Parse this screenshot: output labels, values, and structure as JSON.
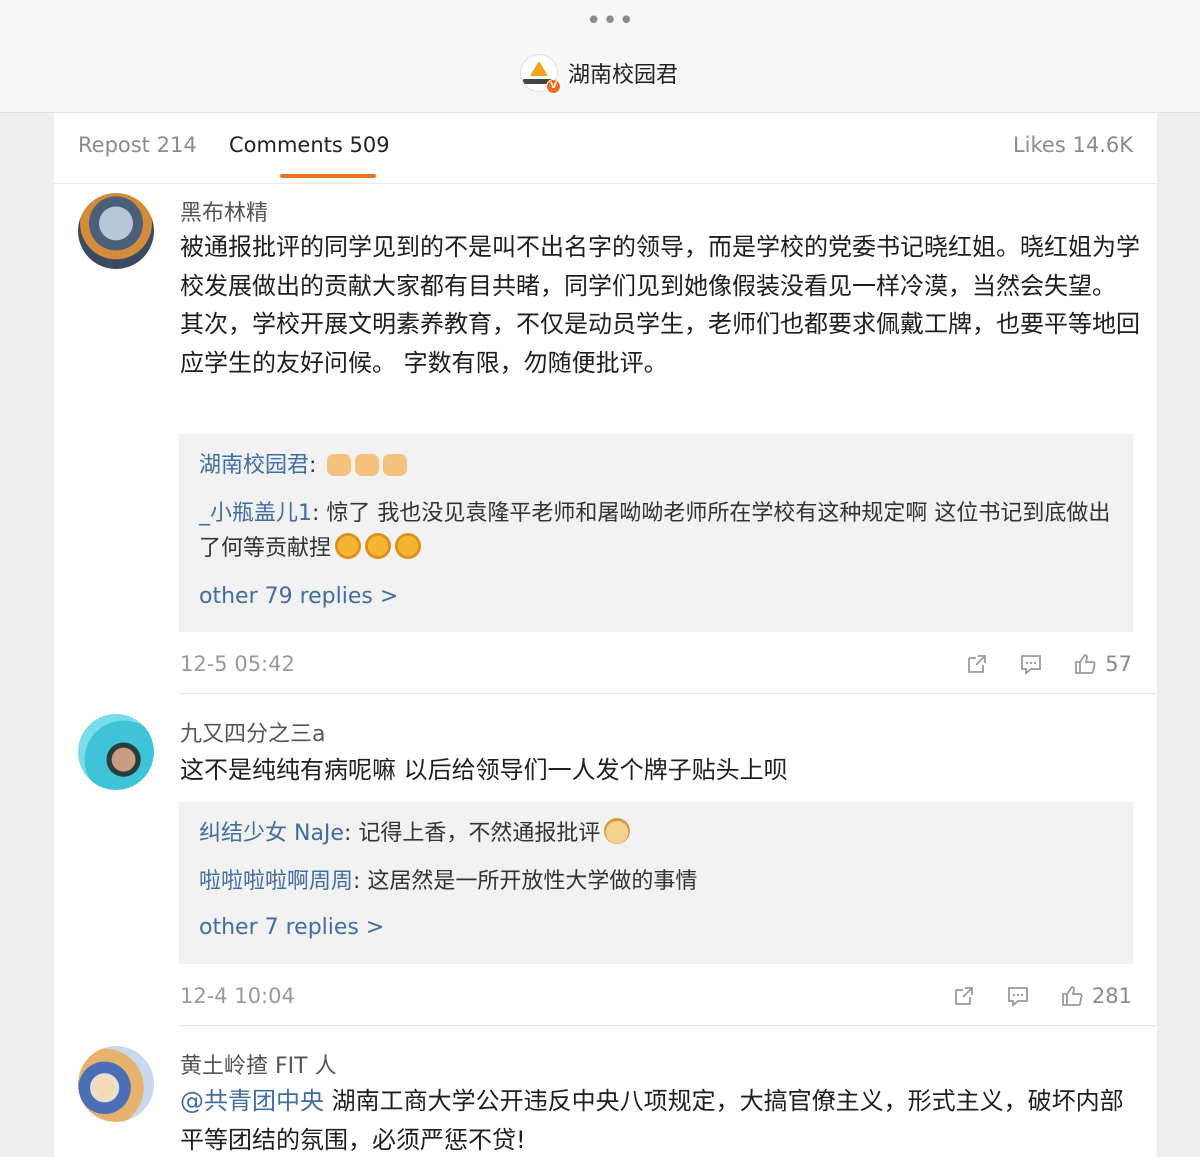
{
  "header": {
    "more_icon": "more-dots-icon",
    "account_name": "湖南校园君",
    "verified_badge": "V"
  },
  "tabs": {
    "repost": "Repost 214",
    "comments": "Comments 509",
    "likes": "Likes 14.6K",
    "active_color": "#f0741f"
  },
  "colors": {
    "link": "#3f6ea3",
    "reply_bg": "#f2f2f2"
  },
  "comments": [
    {
      "user": "黑布林精",
      "text": "被通报批评的同学见到的不是叫不出名字的领导，而是学校的党委书记晓红姐。晓红姐为学校发展做出的贡献大家都有目共睹，同学们见到她像假装没看见一样冷漠，当然会失望。 其次，学校开展文明素养教育，不仅是动员学生，老师们也都要求佩戴工牌，也要平等地回应学生的友好问候。 字数有限，勿随便批评。",
      "replies": [
        {
          "user": "湖南校园君",
          "text": "",
          "emojis": [
            "thumbs-up-emoji",
            "thumbs-up-emoji",
            "thumbs-up-emoji"
          ]
        },
        {
          "user": "_小瓶盖儿1",
          "text": "惊了 我也没见袁隆平老师和屠呦呦老师所在学校有这种规定啊  这位书记到底做出了何等贡献捏",
          "emojis": [
            "shocked-emoji",
            "shocked-emoji",
            "shocked-emoji"
          ]
        }
      ],
      "more_replies": "other 79 replies >",
      "time": "12-5 05:42",
      "likes": "57"
    },
    {
      "user": "九又四分之三a",
      "text": "这不是纯纯有病呢嘛 以后给领导们一人发个牌子贴头上呗",
      "replies": [
        {
          "user": "纠结少女 NaJe",
          "text": "记得上香，不然通报批评",
          "emojis": [
            "doge-emoji"
          ]
        },
        {
          "user": "啦啦啦啦啊周周",
          "text": "这居然是一所开放性大学做的事情",
          "emojis": []
        }
      ],
      "more_replies": "other 7 replies >",
      "time": "12-4 10:04",
      "likes": "281"
    },
    {
      "user": "黄土岭揸 FIT 人",
      "mention": "@共青团中央",
      "text": " 湖南工商大学公开违反中央八项规定，大搞官僚主义，形式主义，破坏内部平等团结的氛围，必须严惩不贷!"
    }
  ]
}
